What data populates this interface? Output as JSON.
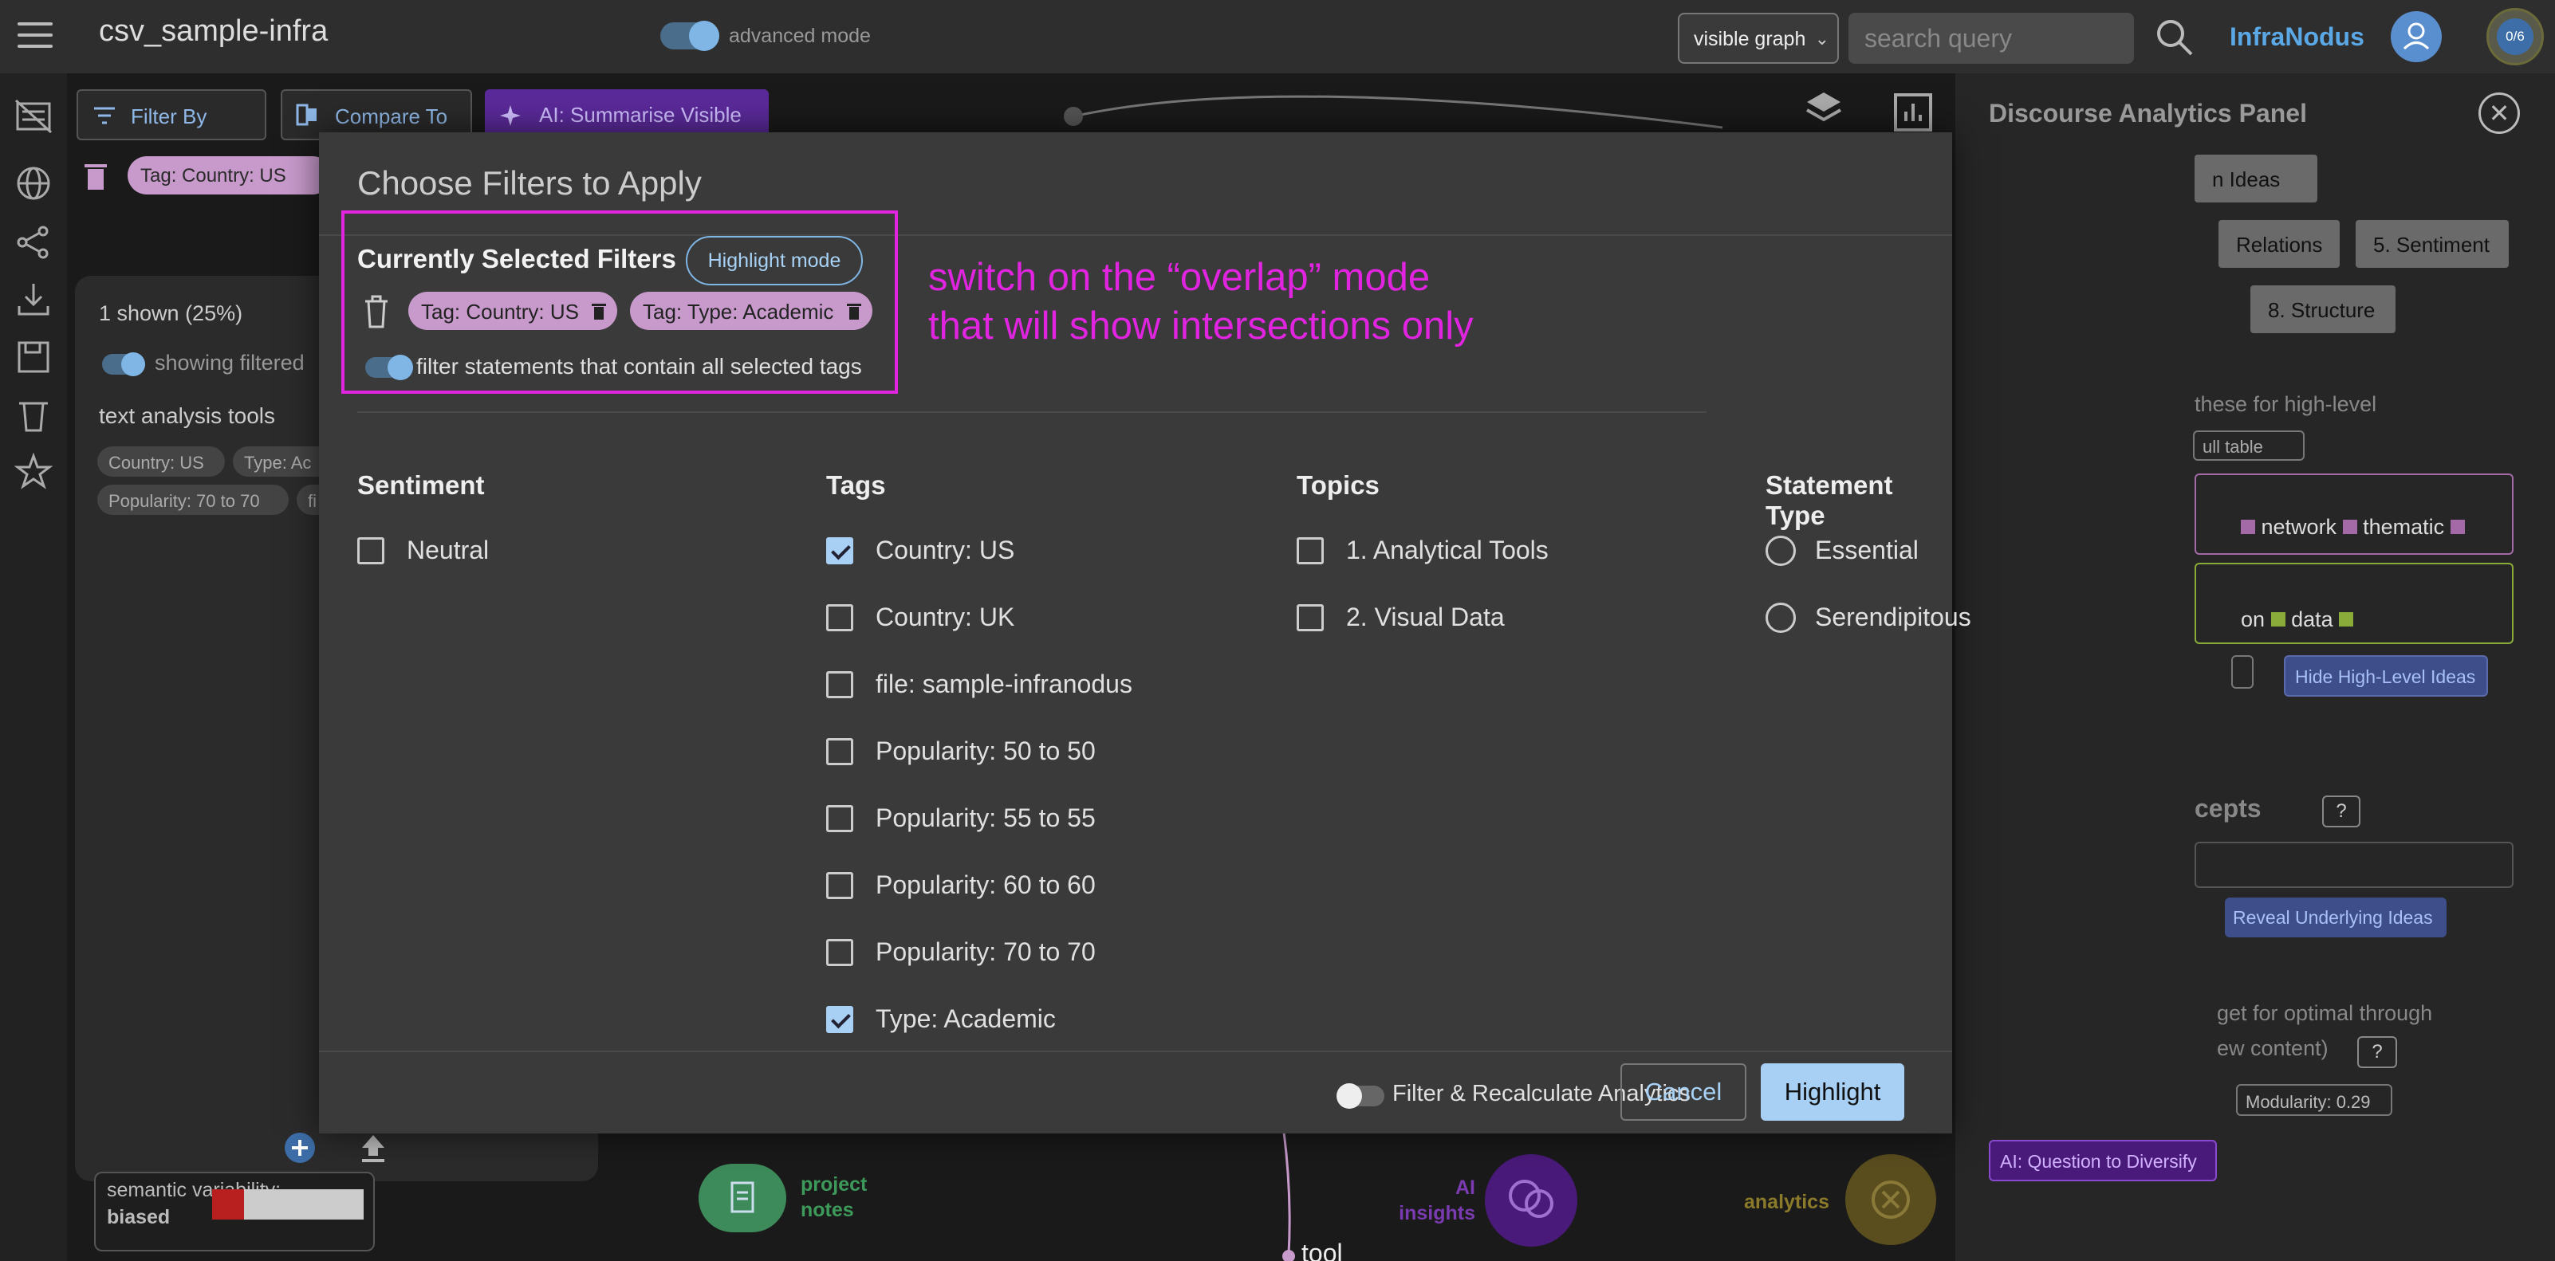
{
  "header": {
    "menu_icon": "hamburger-menu-icon",
    "title": "csv_sample-infra",
    "advanced_mode_label": "advanced mode",
    "graph_select_value": "visible graph",
    "search_placeholder": "search query",
    "brand": "InfraNodus",
    "quota": "0/6"
  },
  "toolbar": {
    "filter_by": "Filter By",
    "compare_to": "Compare To",
    "ai_summarise": "AI: Summarise Visible",
    "active_tag": "Tag: Country: US"
  },
  "left_panel": {
    "shown": "1 shown (25%)",
    "showing_filtered": "showing filtered",
    "statement": "text analysis tools",
    "chips": [
      "Country: US",
      "Type: Ac",
      "Popularity: 70 to 70",
      "fi"
    ],
    "semantic_variability_label": "semantic variability:",
    "semantic_variability_value": "biased",
    "semantic_variability_level": 0.2
  },
  "graph_nodes": {
    "project_notes": "project notes",
    "ai_insights": "AI insights",
    "analytics": "analytics",
    "tool": "tool"
  },
  "right_panel": {
    "title": "Discourse Analytics Panel",
    "buttons": [
      "n Ideas",
      "Relations",
      "5. Sentiment",
      "8. Structure"
    ],
    "high_level_text": "these for high-level",
    "full_table": "ull table",
    "row1_words": [
      "network",
      "thematic"
    ],
    "row2_words": [
      "on",
      "data"
    ],
    "hide_high_level": "Hide High-Level Ideas",
    "concepts_heading": "cepts",
    "help": "?",
    "reveal_underlying": "Reveal Underlying Ideas",
    "optimal_text_1": "get for optimal through",
    "optimal_text_2": "ew content)",
    "modularity": "Modularity: 0.29",
    "ai_question": "AI: Question to Diversify"
  },
  "modal": {
    "title": "Choose Filters to Apply",
    "selected_heading": "Currently Selected Filters",
    "highlight_mode": "Highlight mode",
    "selected_tags": [
      "Tag: Country: US",
      "Tag: Type: Academic"
    ],
    "overlap_label": "filter statements that contain all selected tags",
    "annotation_line1": "switch on the “overlap” mode",
    "annotation_line2": "that will show intersections only",
    "columns": {
      "sentiment": {
        "heading": "Sentiment",
        "options": [
          {
            "label": "Neutral",
            "checked": false
          }
        ]
      },
      "tags": {
        "heading": "Tags",
        "options": [
          {
            "label": "Country: US",
            "checked": true
          },
          {
            "label": "Country: UK",
            "checked": false
          },
          {
            "label": "file: sample-infranodus",
            "checked": false
          },
          {
            "label": "Popularity: 50 to 50",
            "checked": false
          },
          {
            "label": "Popularity: 55 to 55",
            "checked": false
          },
          {
            "label": "Popularity: 60 to 60",
            "checked": false
          },
          {
            "label": "Popularity: 70 to 70",
            "checked": false
          },
          {
            "label": "Type: Academic",
            "checked": true
          }
        ]
      },
      "topics": {
        "heading": "Topics",
        "options": [
          {
            "label": "1. Analytical Tools",
            "checked": false
          },
          {
            "label": "2. Visual Data",
            "checked": false
          }
        ]
      },
      "statement_type": {
        "heading": "Statement Type",
        "options": [
          {
            "label": "Essential",
            "checked": false
          },
          {
            "label": "Serendipitous",
            "checked": false
          }
        ]
      }
    },
    "recalc_label": "Filter & Recalculate Analytics",
    "cancel": "Cancel",
    "highlight": "Highlight"
  },
  "colors": {
    "accent": "#5ba8e6",
    "tag_pill": "#c79acb",
    "annotation": "#e024e0",
    "primary_button": "#a8d0f5"
  }
}
